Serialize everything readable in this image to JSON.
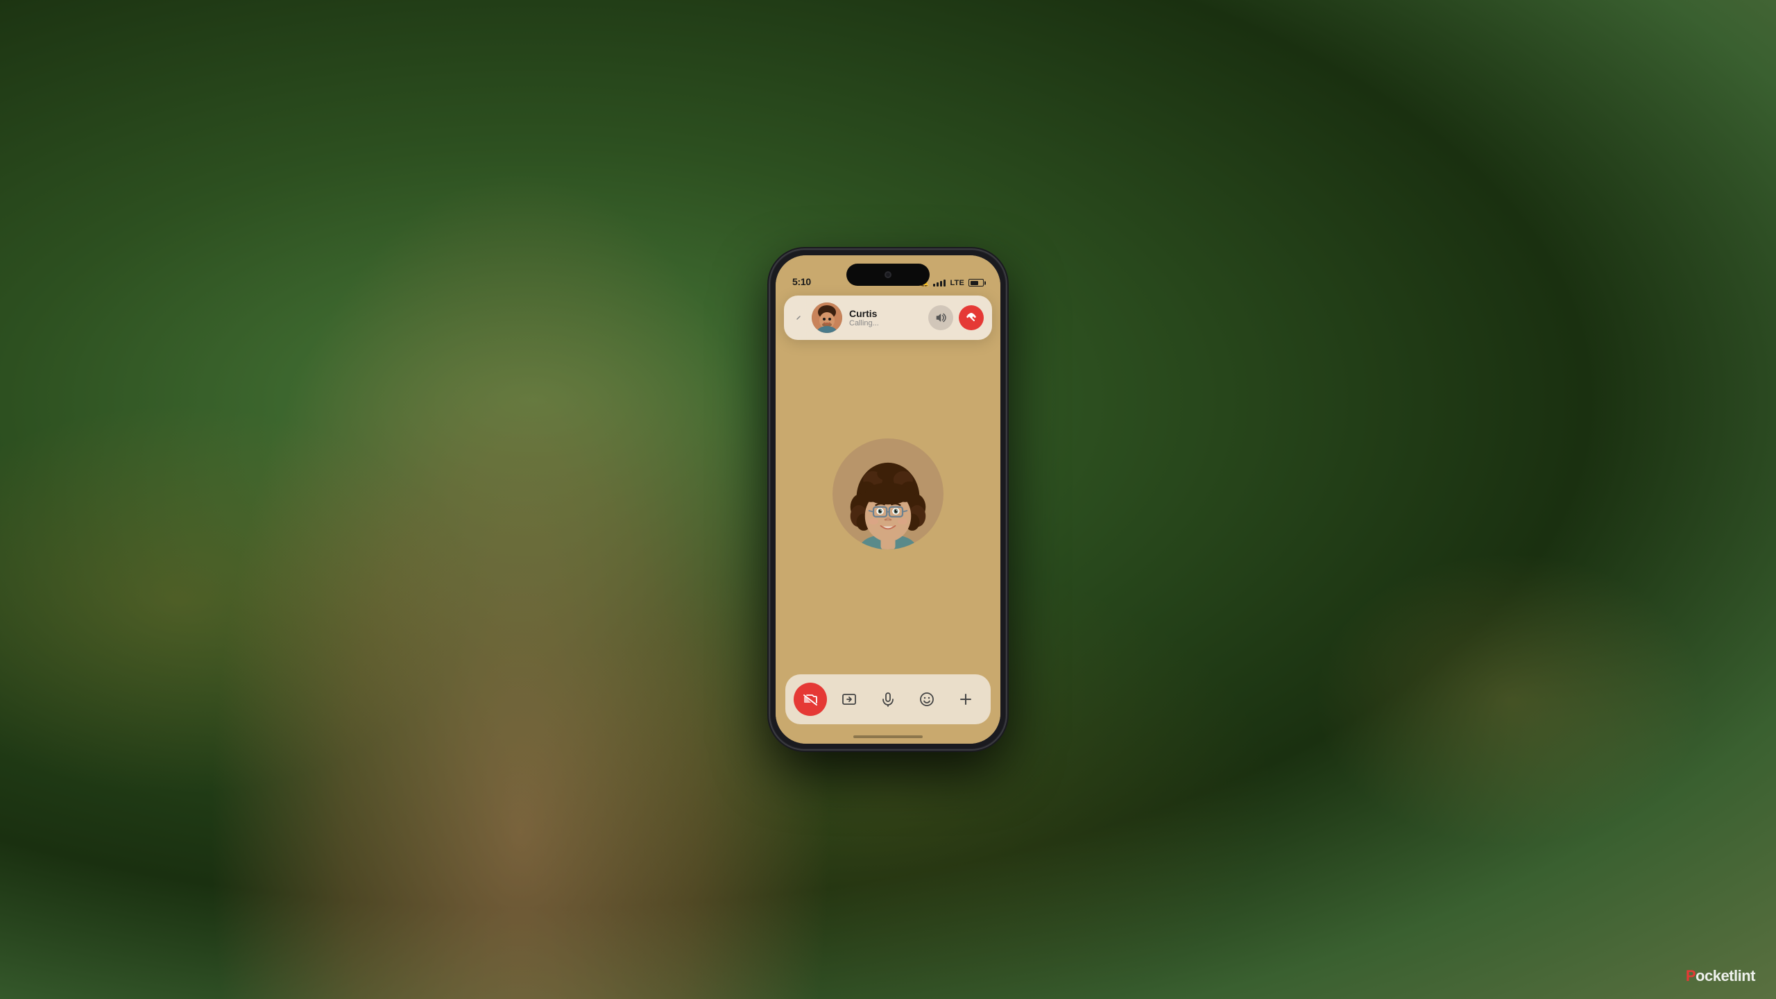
{
  "background": {
    "description": "Blurred outdoor nature background, green bokeh"
  },
  "phone": {
    "status_bar": {
      "time": "5:10",
      "alert_icon": "🔔",
      "signal": "●●●",
      "network": "LTE",
      "battery_level": 70
    },
    "call_banner": {
      "chevron": "›",
      "contact_name": "Curtis",
      "call_status": "Calling...",
      "speaker_btn_label": "🔊",
      "decline_btn_label": "📞"
    },
    "screen": {
      "background_color": "#c9a96e",
      "contact_avatar_description": "Female memoji with curly brown hair and glasses"
    },
    "controls": {
      "buttons": [
        {
          "id": "camera-off",
          "icon": "📷",
          "active": true,
          "label": "Camera Off"
        },
        {
          "id": "flip",
          "icon": "⊡",
          "active": false,
          "label": "Flip Camera"
        },
        {
          "id": "mute",
          "icon": "🎙",
          "active": false,
          "label": "Mute"
        },
        {
          "id": "emoji",
          "icon": "☺",
          "active": false,
          "label": "Emoji"
        },
        {
          "id": "add",
          "icon": "+",
          "active": false,
          "label": "Add"
        }
      ]
    }
  },
  "watermark": {
    "brand": "Pocketlint",
    "dot_char": "●"
  }
}
